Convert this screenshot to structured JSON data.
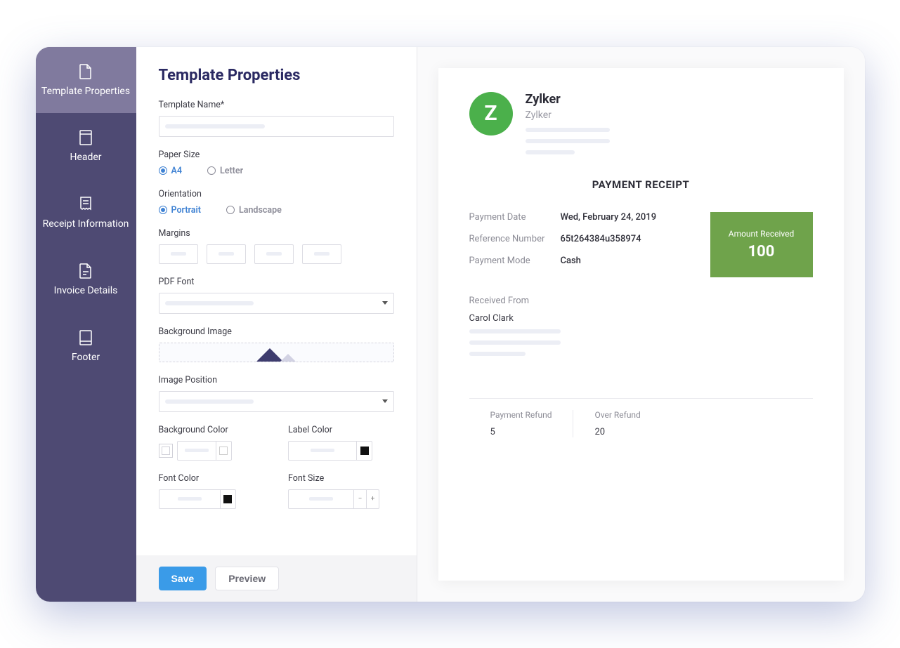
{
  "sidebar": {
    "items": [
      {
        "label": "Template Properties"
      },
      {
        "label": "Header"
      },
      {
        "label": "Receipt Information"
      },
      {
        "label": "Invoice Details"
      },
      {
        "label": "Footer"
      }
    ]
  },
  "form": {
    "title": "Template Properties",
    "templateName": {
      "label": "Template Name*"
    },
    "paperSize": {
      "label": "Paper Size",
      "options": [
        "A4",
        "Letter"
      ],
      "selected": "A4"
    },
    "orientation": {
      "label": "Orientation",
      "options": [
        "Portrait",
        "Landscape"
      ],
      "selected": "Portrait"
    },
    "margins": {
      "label": "Margins"
    },
    "pdfFont": {
      "label": "PDF Font"
    },
    "backgroundImage": {
      "label": "Background Image"
    },
    "imagePosition": {
      "label": "Image Position"
    },
    "backgroundColor": {
      "label": "Background Color",
      "value": "#ffffff"
    },
    "labelColor": {
      "label": "Label Color",
      "value": "#111111"
    },
    "fontColor": {
      "label": "Font Color",
      "value": "#111111"
    },
    "fontSize": {
      "label": "Font Size"
    }
  },
  "buttons": {
    "save": "Save",
    "preview": "Preview"
  },
  "receipt": {
    "company": {
      "name": "Zylker",
      "sub": "Zylker",
      "logoLetter": "Z"
    },
    "title": "PAYMENT RECEIPT",
    "paymentDate": {
      "label": "Payment Date",
      "value": "Wed, February 24, 2019"
    },
    "referenceNumber": {
      "label": "Reference Number",
      "value": "65t264384u358974"
    },
    "paymentMode": {
      "label": "Payment Mode",
      "value": "Cash"
    },
    "amount": {
      "label": "Amount Received",
      "value": "100"
    },
    "receivedFrom": {
      "label": "Received From",
      "name": "Carol Clark"
    },
    "paymentRefund": {
      "label": "Payment Refund",
      "value": "5"
    },
    "overRefund": {
      "label": "Over Refund",
      "value": "20"
    }
  }
}
